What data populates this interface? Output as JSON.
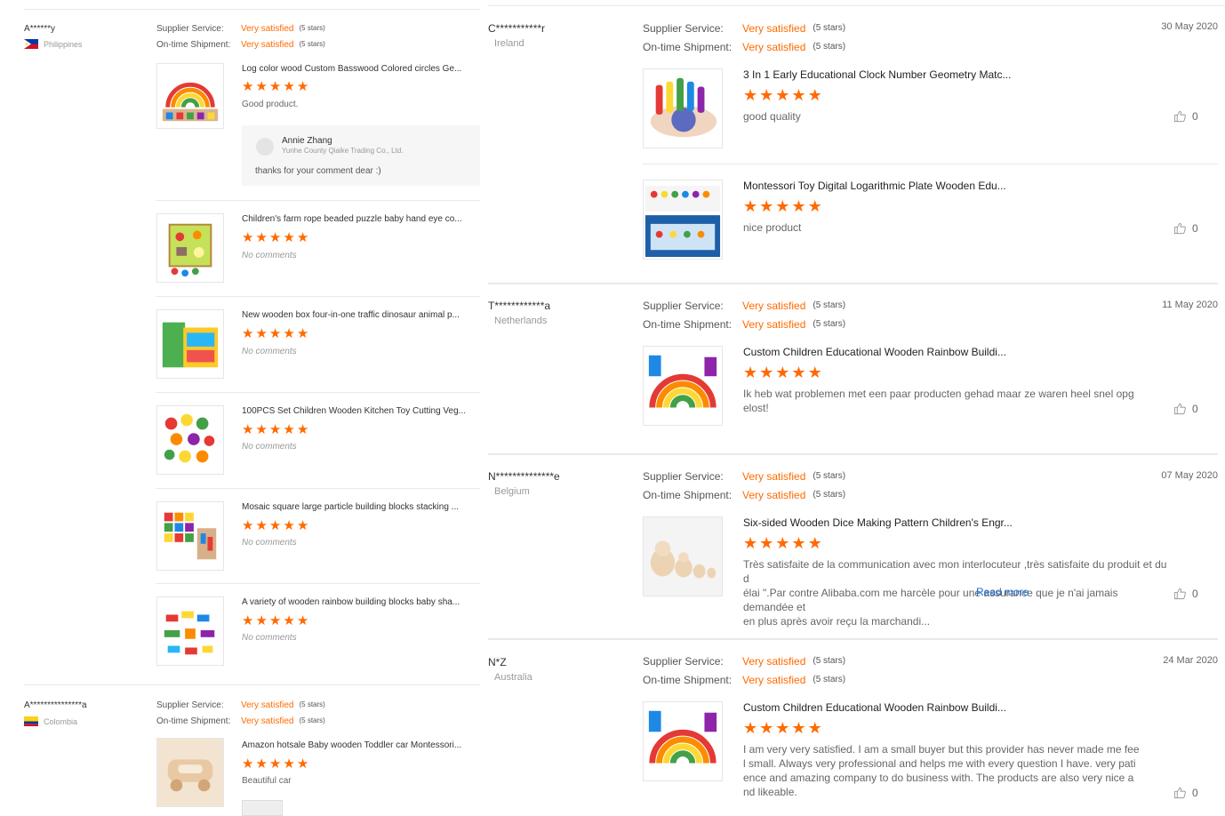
{
  "left": {
    "review1": {
      "user": "A******y",
      "country": "Philippines",
      "supplier_label": "Supplier Service:",
      "supplier_value": "Very satisfied",
      "supplier_count": "(5 stars)",
      "shipment_label": "On-time Shipment:",
      "shipment_value": "Very satisfied",
      "shipment_count": "(5 stars)",
      "items": [
        {
          "title": "Log color wood Custom Basswood Colored circles Ge...",
          "comment": "Good product."
        },
        {
          "title": "Children's farm rope beaded puzzle baby hand eye co...",
          "comment": "No comments"
        },
        {
          "title": "New wooden box four-in-one traffic dinosaur animal p...",
          "comment": "No comments"
        },
        {
          "title": "100PCS Set Children Wooden Kitchen Toy Cutting Veg...",
          "comment": "No comments"
        },
        {
          "title": "Mosaic square large particle building blocks stacking ...",
          "comment": "No comments"
        },
        {
          "title": "A variety of wooden rainbow building blocks baby sha...",
          "comment": "No comments"
        }
      ],
      "reply": {
        "name": "Annie Zhang",
        "company": "Yunhe County Qiaike Trading Co., Ltd.",
        "text": "thanks for your comment dear :)"
      }
    },
    "review2": {
      "user": "A***************a",
      "country": "Colombia",
      "supplier_label": "Supplier Service:",
      "supplier_value": "Very satisfied",
      "supplier_count": "(5 stars)",
      "shipment_label": "On-time Shipment:",
      "shipment_value": "Very satisfied",
      "shipment_count": "(5 stars)",
      "items": [
        {
          "title": "Amazon hotsale Baby wooden Toddler car Montessori...",
          "comment": "Beautiful car"
        }
      ]
    }
  },
  "right": {
    "reviews": [
      {
        "user": "C***********r",
        "country": "Ireland",
        "date": "30 May 2020",
        "supplier_label": "Supplier Service:",
        "supplier_value": "Very satisfied",
        "supplier_count": "(5 stars)",
        "shipment_label": "On-time Shipment:",
        "shipment_value": "Very satisfied",
        "shipment_count": "(5 stars)",
        "items": [
          {
            "title": "3 In 1 Early Educational Clock Number Geometry Matc...",
            "comment": "good quality",
            "likes": "0"
          },
          {
            "title": "Montessori Toy Digital Logarithmic Plate Wooden Edu...",
            "comment": "nice product",
            "likes": "0"
          }
        ]
      },
      {
        "user": "T************a",
        "country": "Netherlands",
        "date": "11 May 2020",
        "supplier_label": "Supplier Service:",
        "supplier_value": "Very satisfied",
        "supplier_count": "(5 stars)",
        "shipment_label": "On-time Shipment:",
        "shipment_value": "Very satisfied",
        "shipment_count": "(5 stars)",
        "items": [
          {
            "title": "Custom Children Educational Wooden Rainbow Buildi...",
            "comment_l1": "Ik heb wat problemen met een paar producten gehad maar ze waren heel snel opg",
            "comment_l2": "elost!",
            "likes": "0"
          }
        ]
      },
      {
        "user": "N**************e",
        "country": "Belgium",
        "date": "07 May 2020",
        "supplier_label": "Supplier Service:",
        "supplier_value": "Very satisfied",
        "supplier_count": "(5 stars)",
        "shipment_label": "On-time Shipment:",
        "shipment_value": "Very satisfied",
        "shipment_count": "(5 stars)",
        "items": [
          {
            "title": "Six-sided Wooden Dice Making Pattern Children's Engr...",
            "comment_l1": "Très satisfaite de la communication avec mon interlocuteur ,très satisfaite du produit et du d",
            "comment_l2": "élai \".Par contre Alibaba.com me harcèle pour une assurance que je n'ai jamais demandée et",
            "comment_l3": "en plus après avoir reçu la marchandi...",
            "read_more": "Read more",
            "likes": "0"
          }
        ]
      },
      {
        "user": "N*Z",
        "country": "Australia",
        "date": "24 Mar 2020",
        "supplier_label": "Supplier Service:",
        "supplier_value": "Very satisfied",
        "supplier_count": "(5 stars)",
        "shipment_label": "On-time Shipment:",
        "shipment_value": "Very satisfied",
        "shipment_count": "(5 stars)",
        "items": [
          {
            "title": "Custom Children Educational Wooden Rainbow Buildi...",
            "comment_l1": "I am very very satisfied. I am a small buyer but this provider has never made me fee",
            "comment_l2": "l small. Always very professional and helps me with every question I have. very pati",
            "comment_l3": "ence and amazing company to do business with. The products are also very nice a",
            "comment_l4": "nd likeable.",
            "likes": "0"
          }
        ]
      }
    ]
  },
  "rating": {
    "stars": 5
  },
  "colors": {
    "accent": "#ff6a00",
    "link": "#1a6ed8",
    "divider": "#e8e8e8"
  },
  "icons": {
    "star": "★",
    "like": "thumbs-up-icon"
  }
}
